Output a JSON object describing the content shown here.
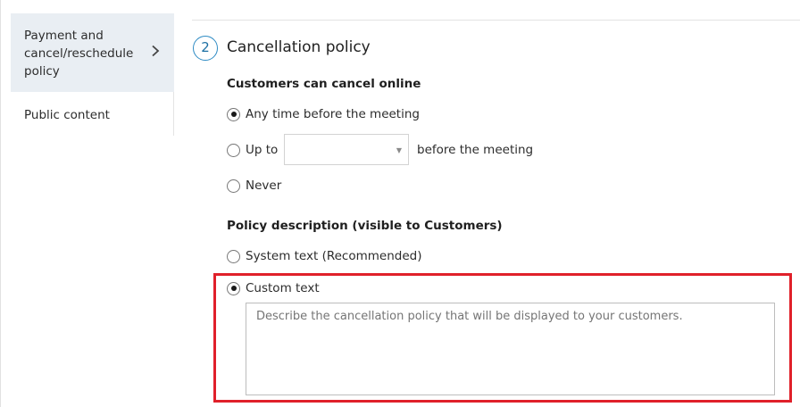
{
  "sidebar": {
    "items": [
      {
        "label": "Payment and cancel/reschedule policy",
        "active": true
      },
      {
        "label": "Public content",
        "active": false
      }
    ]
  },
  "section": {
    "step_number": "2",
    "title": "Cancellation policy"
  },
  "cancel_online": {
    "heading": "Customers can cancel online",
    "options": [
      {
        "label": "Any time before the meeting",
        "checked": true
      },
      {
        "label": "Up to",
        "checked": false
      },
      {
        "label": "Never",
        "checked": false
      }
    ],
    "up_to_select_value": "",
    "after_select_text": "before the meeting"
  },
  "policy_description": {
    "heading": "Policy description (visible to Customers)",
    "options": [
      {
        "label": "System text (Recommended)",
        "checked": false
      },
      {
        "label": "Custom text",
        "checked": true
      }
    ],
    "custom_text_placeholder": "Describe the cancellation policy that will be displayed to your customers.",
    "custom_text_value": ""
  },
  "colors": {
    "accent": "#2e8bc4",
    "highlight": "#e0202a",
    "sidebar_active_bg": "#e9eef3"
  },
  "icons": {
    "sidebar_chevron": "chevron-right-icon",
    "select_arrow": "caret-down-icon"
  }
}
